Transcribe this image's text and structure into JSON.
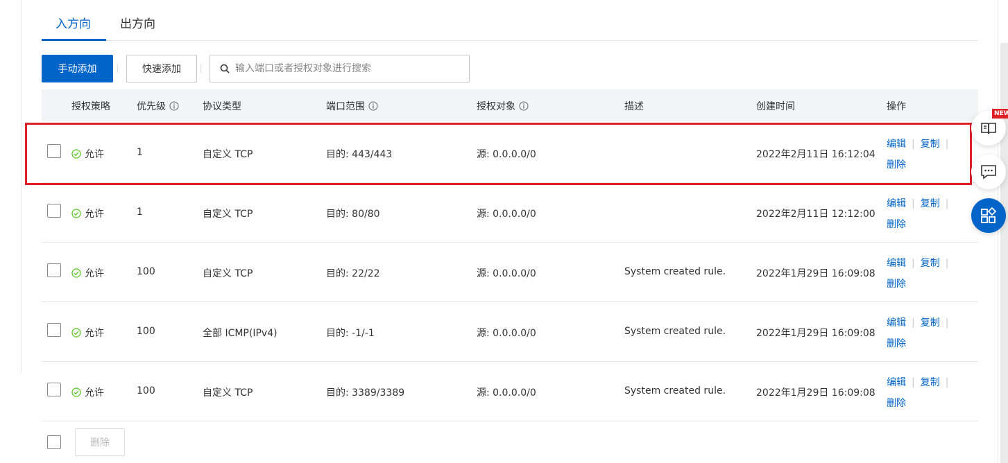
{
  "tabs": {
    "inbound": "入方向",
    "outbound": "出方向"
  },
  "toolbar": {
    "manual_add": "手动添加",
    "quick_add": "快速添加",
    "search_placeholder": "输入端口或者授权对象进行搜索"
  },
  "columns": {
    "policy": "授权策略",
    "priority": "优先级",
    "protocol": "协议类型",
    "port_range": "端口范围",
    "auth_object": "授权对象",
    "description": "描述",
    "created_at": "创建时间",
    "actions": "操作"
  },
  "rows": [
    {
      "policy": "允许",
      "priority": "1",
      "protocol": "自定义 TCP",
      "port": "目的: 443/443",
      "source": "源: 0.0.0.0/0",
      "description": "",
      "created": "2022年2月11日 16:12:04"
    },
    {
      "policy": "允许",
      "priority": "1",
      "protocol": "自定义 TCP",
      "port": "目的: 80/80",
      "source": "源: 0.0.0.0/0",
      "description": "",
      "created": "2022年2月11日 12:12:00"
    },
    {
      "policy": "允许",
      "priority": "100",
      "protocol": "自定义 TCP",
      "port": "目的: 22/22",
      "source": "源: 0.0.0.0/0",
      "description": "System created rule.",
      "created": "2022年1月29日 16:09:08"
    },
    {
      "policy": "允许",
      "priority": "100",
      "protocol": "全部 ICMP(IPv4)",
      "port": "目的: -1/-1",
      "source": "源: 0.0.0.0/0",
      "description": "System created rule.",
      "created": "2022年1月29日 16:09:08"
    },
    {
      "policy": "允许",
      "priority": "100",
      "protocol": "自定义 TCP",
      "port": "目的: 3389/3389",
      "source": "源: 0.0.0.0/0",
      "description": "System created rule.",
      "created": "2022年1月29日 16:09:08"
    }
  ],
  "row_actions": {
    "edit": "编辑",
    "copy": "复制",
    "delete": "删除"
  },
  "footer": {
    "delete": "删除"
  },
  "float": {
    "new_badge": "NEW"
  },
  "colors": {
    "accent": "#0064c8",
    "allow_green": "#52c41a",
    "highlight_red": "#e02027"
  }
}
